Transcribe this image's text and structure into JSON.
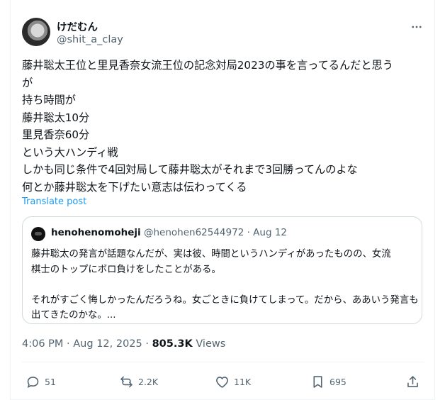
{
  "author": {
    "display_name": "けだむん",
    "handle": "@shit_a_clay"
  },
  "tweet": {
    "lines": [
      "藤井聡太王位と里見香奈女流王位の記念対局2023の事を言ってるんだと思う",
      "が",
      "持ち時間が",
      "藤井聡太10分",
      "里見香奈60分",
      "という大ハンディ戦",
      "しかも同じ条件で4回対局して藤井聡太がそれまで3回勝ってんのよな",
      "何とか藤井聡太を下げたい意志は伝わってくる"
    ],
    "translate_label": "Translate post"
  },
  "quote": {
    "display_name": "henohenomoheji",
    "handle": "@henohen62544972",
    "separator": "·",
    "date": "Aug 12",
    "lines": [
      "藤井聡太の発言が話題なんだが、実は彼、時間というハンディがあったものの、女流",
      "棋士のトップにボロ負けをしたことがある。",
      "",
      "それがすごく悔しかったんだろうね。女ごときに負けてしまって。だから、ああいう発言も",
      "出てきたのかな。..."
    ]
  },
  "meta": {
    "time": "4:06 PM",
    "date": "Aug 12, 2025",
    "views_count": "805.3K",
    "views_label": "Views"
  },
  "actions": {
    "replies": "51",
    "reposts": "2.2K",
    "likes": "11K",
    "bookmarks": "695"
  },
  "colors": {
    "text": "#0f1419",
    "secondary": "#536471",
    "link": "#1d9bf0",
    "border": "#cfd9de"
  }
}
